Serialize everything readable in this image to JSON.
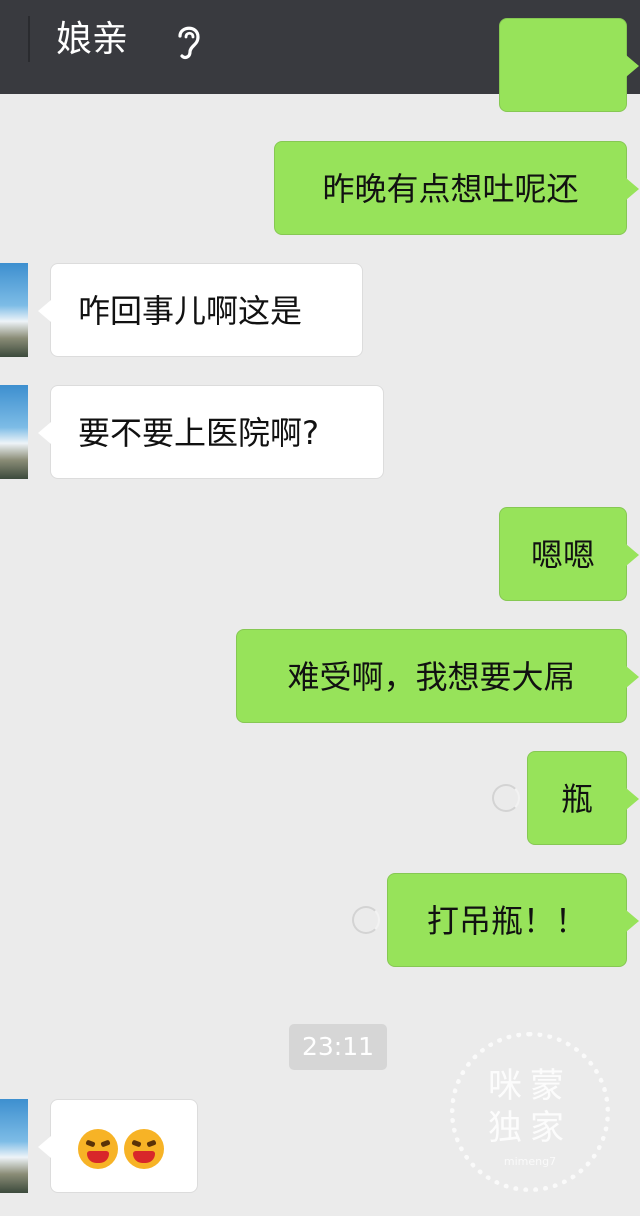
{
  "header": {
    "title": "娘亲",
    "voice_icon": "ear-icon"
  },
  "messages": [
    {
      "side": "out",
      "text": ""
    },
    {
      "side": "out",
      "text": "昨晚有点想吐呢还"
    },
    {
      "side": "in",
      "text": "咋回事儿啊这是"
    },
    {
      "side": "in",
      "text": "要不要上医院啊?"
    },
    {
      "side": "out",
      "text": "嗯嗯"
    },
    {
      "side": "out",
      "text": "难受啊，我想要大屌"
    },
    {
      "side": "out",
      "text": "瓶",
      "status": "sending"
    },
    {
      "side": "out",
      "text": "打吊瓶！！",
      "status": "sending"
    },
    {
      "side": "in",
      "emoji": [
        "angry-face-emoji",
        "angry-face-emoji"
      ]
    }
  ],
  "timestamp": "23:11",
  "watermark": {
    "line1": "咪蒙",
    "line2": "独家",
    "small": "mimeng7"
  },
  "colors": {
    "header": "#393a3f",
    "background": "#ebebeb",
    "out_bubble": "#97e35a",
    "in_bubble": "#ffffff"
  }
}
